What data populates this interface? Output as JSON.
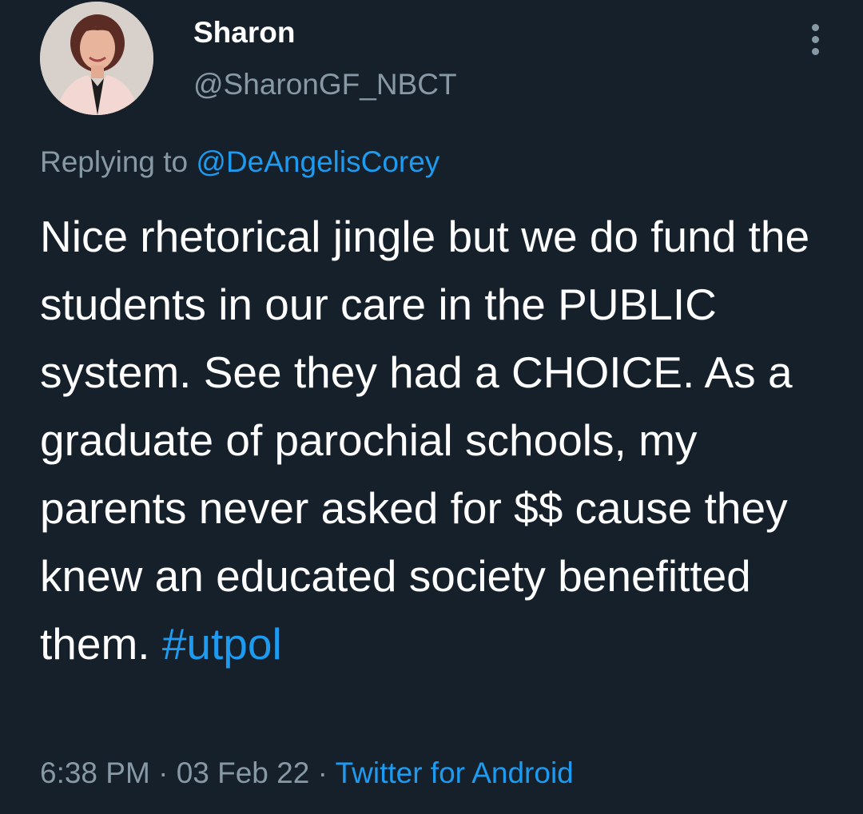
{
  "author": {
    "name": "Sharon",
    "handle": "@SharonGF_NBCT",
    "avatar_icon": "profile-photo"
  },
  "more_icon": "vertical-ellipsis-icon",
  "reply": {
    "prefix": "Replying to",
    "mention": "@DeAngelisCorey"
  },
  "tweet": {
    "text": "Nice rhetorical jingle but we do fund the students in our care in the PUBLIC system. See they had a CHOICE. As a graduate of parochial schools, my parents never asked for $$ cause they knew an educated society benefitted them.",
    "hashtag": "#utpol"
  },
  "meta": {
    "time": "6:38 PM",
    "separator": "·",
    "date": "03 Feb 22",
    "source": "Twitter for Android"
  },
  "colors": {
    "background": "#15202b",
    "secondary_text": "#8899a6",
    "link": "#1d9bf0"
  }
}
